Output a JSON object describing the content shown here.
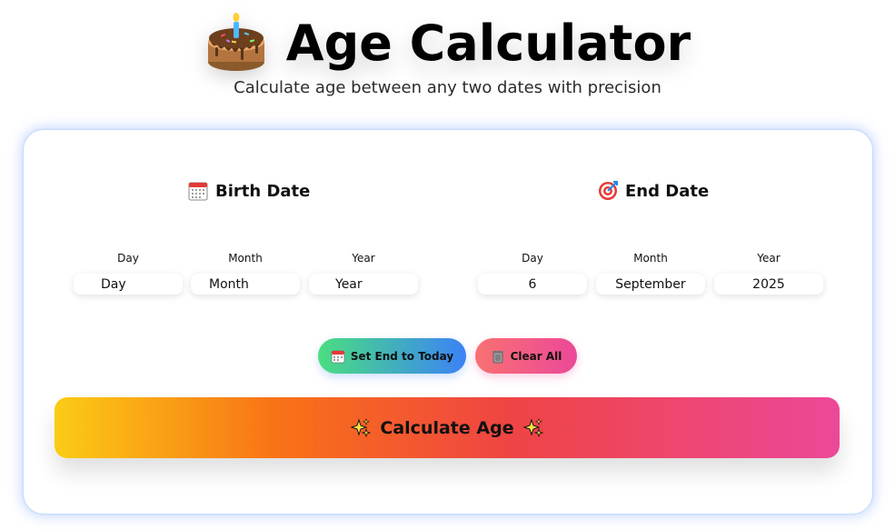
{
  "header": {
    "title": "Age Calculator",
    "subtitle": "Calculate age between any two dates with precision",
    "icon": "cake-icon"
  },
  "birth": {
    "title": "Birth Date",
    "icon": "calendar-icon",
    "labels": {
      "day": "Day",
      "month": "Month",
      "year": "Year"
    },
    "placeholders": {
      "day": "Day",
      "month": "Month",
      "year": "Year"
    }
  },
  "end": {
    "title": "End Date",
    "icon": "target-icon",
    "labels": {
      "day": "Day",
      "month": "Month",
      "year": "Year"
    },
    "values": {
      "day": "6",
      "month": "September",
      "year": "2025"
    }
  },
  "actions": {
    "set_today": "Set End to Today",
    "clear_all": "Clear All",
    "calculate": "Calculate Age",
    "set_today_icon": "calendar-icon",
    "clear_all_icon": "trash-icon",
    "calculate_icon": "sparkles-icon"
  },
  "colors": {
    "card_glow": "#6096fa",
    "today_gradient": [
      "#4ade80",
      "#3b82f6"
    ],
    "clear_gradient": [
      "#f87171",
      "#ec4899"
    ],
    "calc_gradient": [
      "#facc15",
      "#f97316",
      "#ef4444",
      "#ec4899"
    ]
  }
}
